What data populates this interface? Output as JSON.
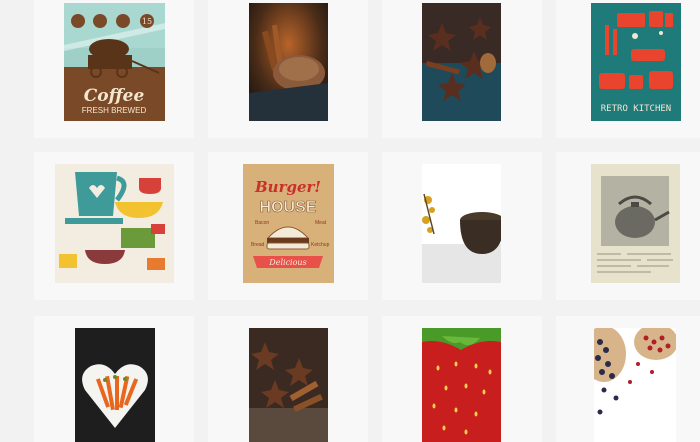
{
  "gallery": {
    "items": [
      {
        "title": "Coffee",
        "subtitle": "FRESH BREWED",
        "badge": "15"
      },
      {
        "title": ""
      },
      {
        "title": ""
      },
      {
        "title": "RETRO KITCHEN"
      },
      {
        "title": ""
      },
      {
        "title_top": "Burger!",
        "title": "HOUSE",
        "tag": "Delicious",
        "words": [
          "Bacon",
          "Meat",
          "Bread",
          "Ketchup"
        ]
      },
      {
        "title": ""
      },
      {
        "title": ""
      },
      {
        "title": ""
      },
      {
        "title": ""
      },
      {
        "title": ""
      },
      {
        "title": ""
      }
    ]
  },
  "colors": {
    "page_bg": "#f2f2f2",
    "tile_bg": "#f8f8f8",
    "coffee_brown": "#7a4a28",
    "teal": "#1f7a7a",
    "burger_red": "#d8403a"
  }
}
